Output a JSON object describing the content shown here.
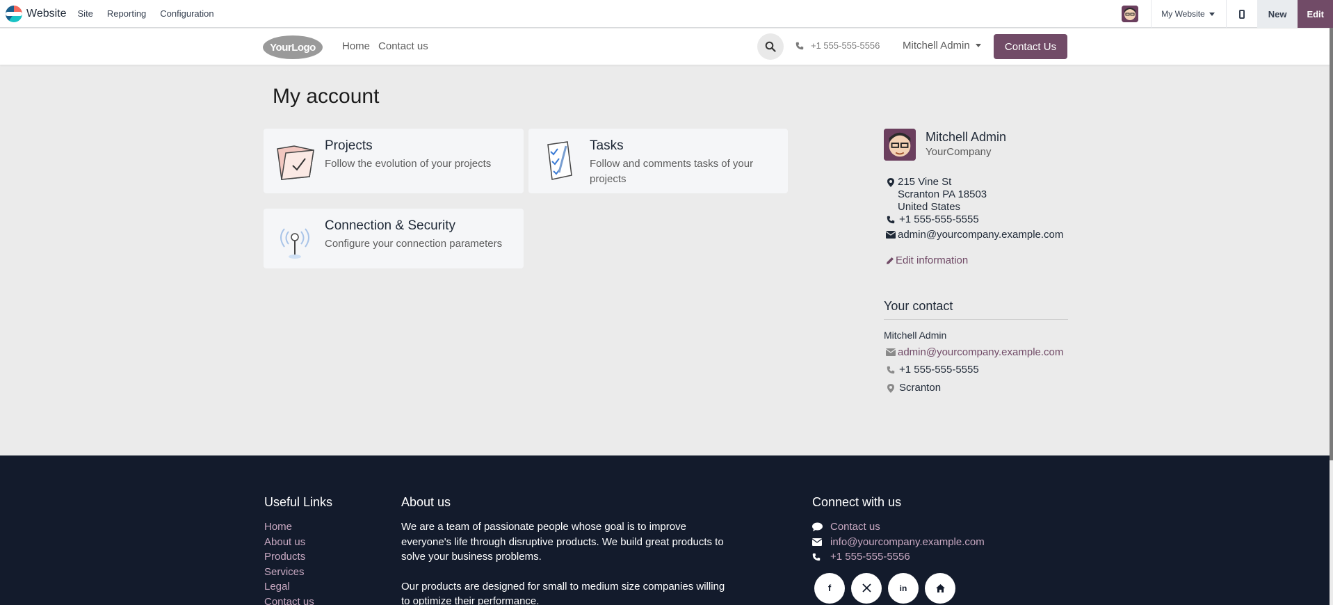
{
  "admin_bar": {
    "app_name": "Website",
    "menu": [
      "Site",
      "Reporting",
      "Configuration"
    ],
    "website_selector": "My Website",
    "new_label": "New",
    "edit_label": "Edit"
  },
  "header": {
    "logo_text": "YourLogo",
    "nav": [
      "Home",
      "Contact us"
    ],
    "phone": "+1 555-555-5556",
    "user": "Mitchell Admin",
    "contact_button": "Contact Us"
  },
  "page": {
    "title": "My account",
    "cards": [
      {
        "title": "Projects",
        "desc": "Follow the evolution of your projects",
        "icon": "projects-folder-icon"
      },
      {
        "title": "Tasks",
        "desc": "Follow and comments tasks of your projects",
        "icon": "tasks-checklist-icon"
      },
      {
        "title": "Connection & Security",
        "desc": "Configure your connection parameters",
        "icon": "antenna-icon"
      }
    ]
  },
  "profile": {
    "name": "Mitchell Admin",
    "company": "YourCompany",
    "address": [
      "215 Vine St",
      "Scranton PA 18503",
      "United States"
    ],
    "phone": "+1 555-555-5555",
    "email": "admin@yourcompany.example.com",
    "edit_label": "Edit information"
  },
  "your_contact": {
    "heading": "Your contact",
    "name": "Mitchell Admin",
    "email": "admin@yourcompany.example.com",
    "phone": "+1 555-555-5555",
    "city": "Scranton"
  },
  "footer": {
    "useful_links_heading": "Useful Links",
    "useful_links": [
      "Home",
      "About us",
      "Products",
      "Services",
      "Legal",
      "Contact us"
    ],
    "about_heading": "About us",
    "about_text_1": "We are a team of passionate people whose goal is to improve everyone's life through disruptive products. We build great products to solve your business problems.",
    "about_text_2": "Our products are designed for small to medium size companies willing to optimize their performance.",
    "connect_heading": "Connect with us",
    "connect": {
      "contact": "Contact us",
      "email": "info@yourcompany.example.com",
      "phone": "+1 555-555-5556"
    },
    "socials": [
      "facebook-icon",
      "x-icon",
      "linkedin-icon",
      "home-icon"
    ]
  },
  "colors": {
    "brand": "#714b67",
    "footer_bg": "#131b2c",
    "page_bg": "#ebebeb"
  }
}
